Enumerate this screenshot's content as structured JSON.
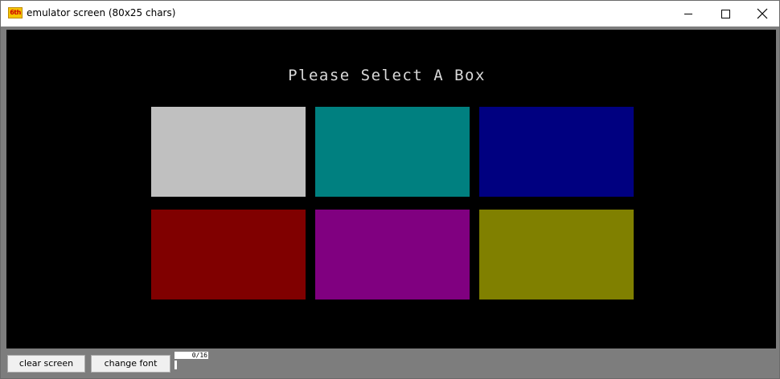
{
  "window": {
    "title": "emulator screen (80x25 chars)",
    "icon_label": "6th"
  },
  "screen": {
    "prompt": "Please Select A Box",
    "boxes": [
      {
        "color": "#c0c0c0"
      },
      {
        "color": "#008080"
      },
      {
        "color": "#000080"
      },
      {
        "color": "#800000"
      },
      {
        "color": "#800080"
      },
      {
        "color": "#808000"
      }
    ]
  },
  "toolbar": {
    "clear_label": "clear screen",
    "font_label": "change font",
    "status": "0/16"
  }
}
